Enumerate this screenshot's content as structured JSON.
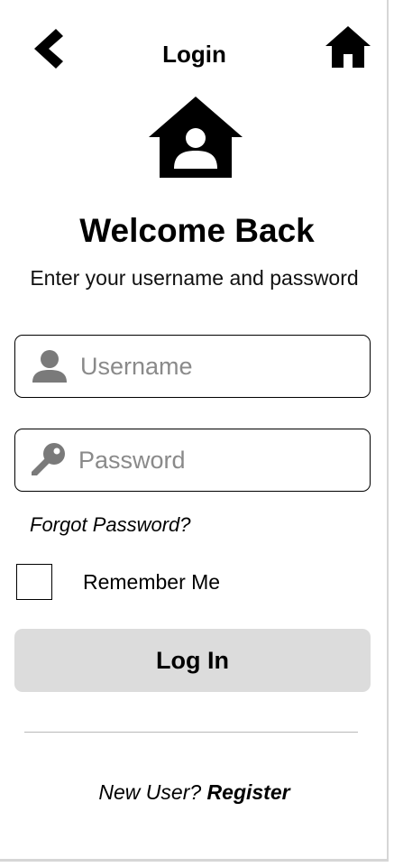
{
  "header": {
    "title": "Login",
    "back_icon": "chevron-left-icon",
    "home_icon": "home-icon"
  },
  "logo": {
    "icon": "home-user-icon"
  },
  "welcome": {
    "title": "Welcome Back",
    "subtitle": "Enter your username and password"
  },
  "form": {
    "username": {
      "icon": "user-icon",
      "placeholder": "Username",
      "value": ""
    },
    "password": {
      "icon": "key-icon",
      "placeholder": "Password",
      "value": ""
    },
    "forgot_label": "Forgot Password?",
    "remember_label": "Remember Me",
    "remember_checked": false,
    "login_label": "Log In"
  },
  "footer": {
    "prompt": "New User?",
    "register_label": "Register"
  },
  "colors": {
    "button_bg": "#dcdcdc",
    "placeholder": "#8a8a8a",
    "icon_gray": "#7a7a7a",
    "divider": "#b8b8b8"
  }
}
